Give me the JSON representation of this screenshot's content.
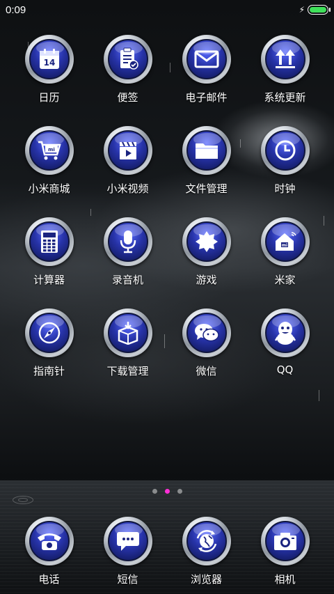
{
  "status_bar": {
    "time": "0:09",
    "battery_level": 1.0,
    "charging": true,
    "battery_color": "#3fe05a"
  },
  "apps": [
    {
      "label": "日历",
      "icon": "calendar-icon",
      "day": "14"
    },
    {
      "label": "便签",
      "icon": "notepad-icon"
    },
    {
      "label": "电子邮件",
      "icon": "envelope-icon"
    },
    {
      "label": "系统更新",
      "icon": "update-arrows-icon"
    },
    {
      "label": "小米商城",
      "icon": "shopping-cart-icon",
      "badge": "mi"
    },
    {
      "label": "小米视频",
      "icon": "clapperboard-icon"
    },
    {
      "label": "文件管理",
      "icon": "folder-icon"
    },
    {
      "label": "时钟",
      "icon": "clock-icon"
    },
    {
      "label": "计算器",
      "icon": "calculator-icon"
    },
    {
      "label": "录音机",
      "icon": "microphone-icon"
    },
    {
      "label": "游戏",
      "icon": "puzzle-icon"
    },
    {
      "label": "米家",
      "icon": "smart-home-icon",
      "badge": "mi"
    },
    {
      "label": "指南针",
      "icon": "compass-icon"
    },
    {
      "label": "下载管理",
      "icon": "download-box-icon"
    },
    {
      "label": "微信",
      "icon": "wechat-icon"
    },
    {
      "label": "QQ",
      "icon": "qq-penguin-icon"
    }
  ],
  "page_indicator": {
    "count": 3,
    "active_index": 1,
    "active_color": "#ff2fd6"
  },
  "dock": [
    {
      "label": "电话",
      "icon": "phone-icon"
    },
    {
      "label": "短信",
      "icon": "message-bubble-icon"
    },
    {
      "label": "浏览器",
      "icon": "browser-globe-icon"
    },
    {
      "label": "相机",
      "icon": "camera-icon"
    }
  ],
  "colors": {
    "icon_blue": "#2733a8",
    "chrome": "#c9ced4"
  }
}
